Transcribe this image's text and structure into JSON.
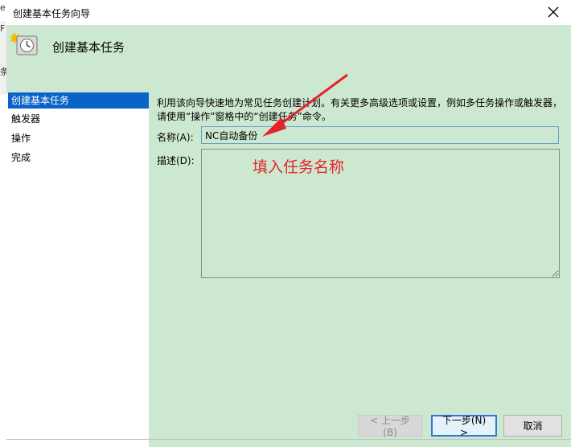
{
  "window": {
    "title": "创建基本任务向导",
    "close_glyph": "✕"
  },
  "background_fragments": [
    "e",
    "F",
    "条"
  ],
  "header": {
    "title": "创建基本任务",
    "icon": "clock-icon"
  },
  "steps": [
    {
      "label": "创建基本任务",
      "active": true
    },
    {
      "label": "触发器",
      "active": false
    },
    {
      "label": "操作",
      "active": false
    },
    {
      "label": "完成",
      "active": false
    }
  ],
  "description_text": "利用该向导快速地为常见任务创建计划。有关更多高级选项或设置，例如多任务操作或触发器，请使用“操作”窗格中的“创建任务”命令。",
  "form": {
    "name_label": "名称(A):",
    "name_value": "NC自动备份",
    "desc_label": "描述(D):",
    "desc_value": ""
  },
  "annotation": {
    "text": "填入任务名称",
    "color": "#e4232c"
  },
  "buttons": {
    "back": "< 上一步(B)",
    "next": "下一步(N) >",
    "cancel": "取消"
  },
  "colors": {
    "panel_green": "#cde8d0",
    "selection_blue": "#0a64c8"
  }
}
